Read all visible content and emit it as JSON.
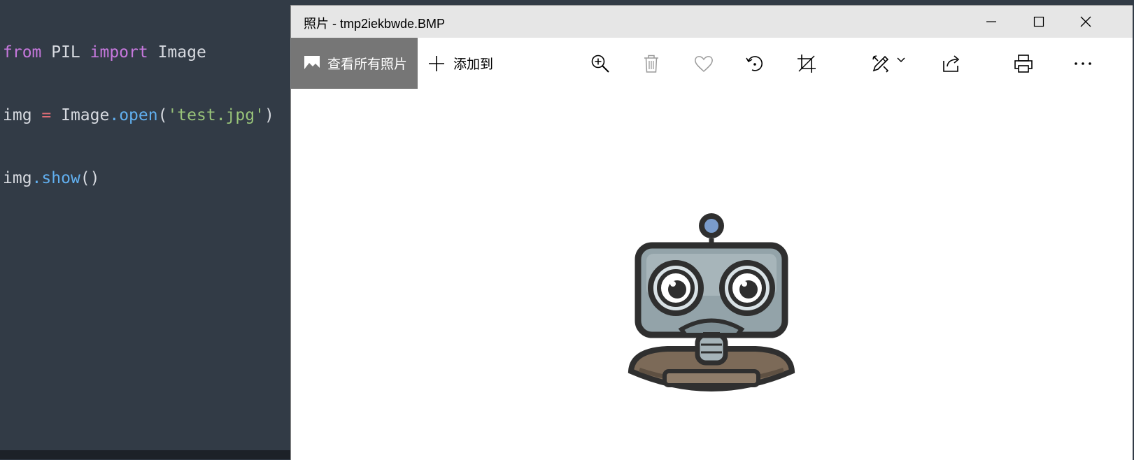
{
  "editor": {
    "line1": {
      "kw1": "from",
      "mod": " PIL ",
      "kw2": "import",
      "name": " Image"
    },
    "line2": {
      "a": "img ",
      "op": "=",
      "b": " Image",
      "dot": ".",
      "fn": "open",
      "p1": "(",
      "str": "'test.jpg'",
      "p2": ")"
    },
    "line3": {
      "a": "img",
      "dot": ".",
      "fn": "show",
      "parens": "()"
    }
  },
  "window": {
    "title": "照片 - tmp2iekbwde.BMP",
    "controls": {
      "minimize": "minimize-icon",
      "maximize": "maximize-icon",
      "close": "close-icon"
    }
  },
  "toolbar": {
    "view_all_label": "查看所有照片",
    "add_to_label": "添加到",
    "tools": [
      "zoom-in-icon",
      "delete-icon",
      "favorite-icon",
      "rotate-icon",
      "crop-icon",
      "edit-icon",
      "share-icon",
      "print-icon",
      "more-icon"
    ]
  },
  "colors": {
    "editor_bg": "#323b46",
    "keyword": "#c678dd",
    "function": "#61afef",
    "string": "#98c379",
    "operator": "#e06c75",
    "titlebar_bg": "#e6e6e6",
    "view_all_bg": "#767676"
  }
}
